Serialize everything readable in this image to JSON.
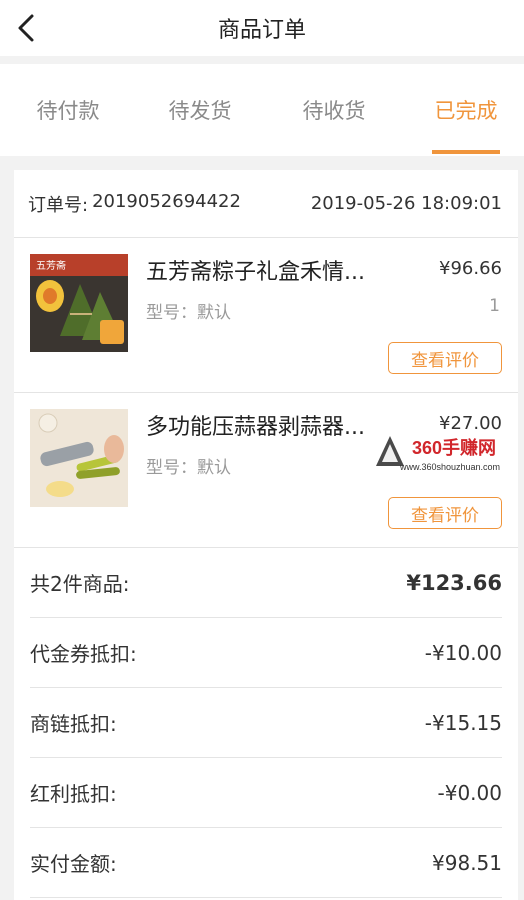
{
  "header": {
    "title": "商品订单"
  },
  "tabs": [
    {
      "label": "待付款"
    },
    {
      "label": "待发货"
    },
    {
      "label": "待收货"
    },
    {
      "label": "已完成"
    }
  ],
  "order": {
    "number_label": "订单号:",
    "number": "2019052694422",
    "datetime": "2019-05-26 18:09:01"
  },
  "products": [
    {
      "name": "五芳斋粽子礼盒禾情...",
      "price": "¥96.66",
      "spec": "型号：默认",
      "qty": "1",
      "review_label": "查看评价",
      "thumb_brand": "五芳斋"
    },
    {
      "name": "多功能压蒜器剥蒜器...",
      "price": "¥27.00",
      "spec": "型号：默认",
      "qty": "",
      "review_label": "查看评价"
    }
  ],
  "summary": [
    {
      "label": "共2件商品:",
      "value": "¥123.66"
    },
    {
      "label": "代金券抵扣:",
      "value": "-¥10.00"
    },
    {
      "label": "商链抵扣:",
      "value": "-¥15.15"
    },
    {
      "label": "红利抵扣:",
      "value": "-¥0.00"
    },
    {
      "label": "实付金额:",
      "value": "¥98.51"
    }
  ],
  "watermark": {
    "brand": "360手赚网",
    "url": "www.360shouzhuan.com"
  },
  "colors": {
    "accent": "#f0953c",
    "background": "#f2f2f2"
  }
}
